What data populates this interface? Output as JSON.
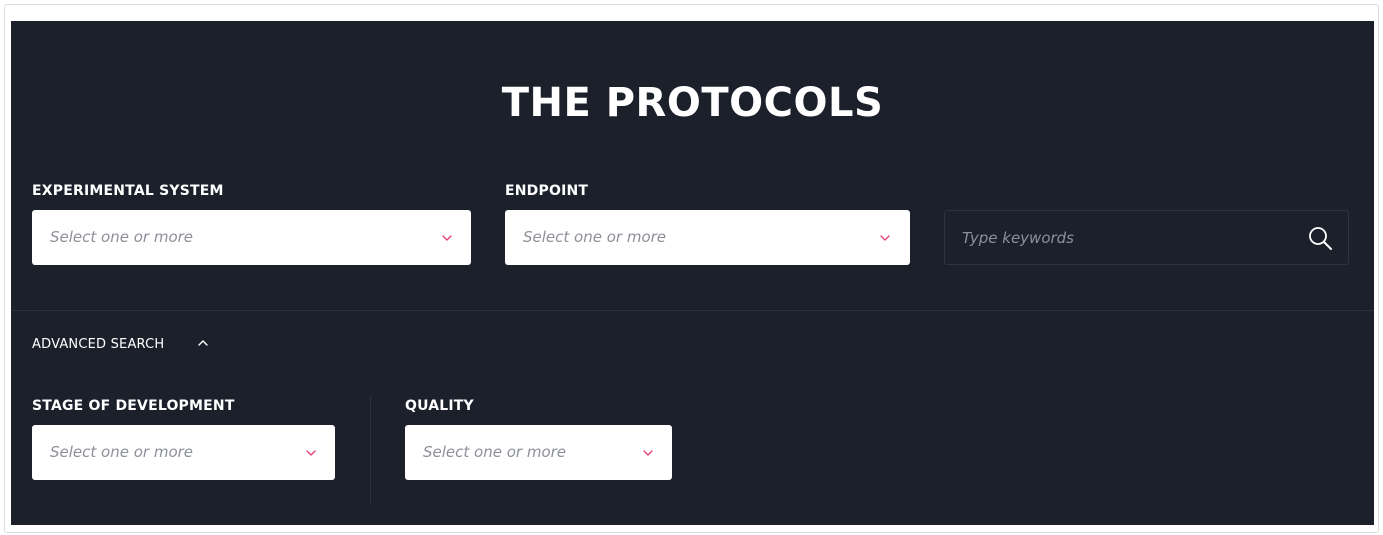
{
  "header": {
    "title": "THE PROTOCOLS"
  },
  "filters": {
    "experimental_system": {
      "label": "EXPERIMENTAL SYSTEM",
      "placeholder": "Select one or more"
    },
    "endpoint": {
      "label": "ENDPOINT",
      "placeholder": "Select one or more"
    },
    "keywords": {
      "placeholder": "Type keywords"
    }
  },
  "advanced": {
    "label": "ADVANCED SEARCH",
    "expanded": true,
    "stage_of_development": {
      "label": "STAGE OF DEVELOPMENT",
      "placeholder": "Select one or more"
    },
    "quality": {
      "label": "QUALITY",
      "placeholder": "Select one or more"
    }
  },
  "colors": {
    "panel_bg": "#1b202b",
    "chevron_accent": "#e3447a",
    "placeholder_text": "#8d9099",
    "label_text": "#ffffff"
  },
  "icons": {
    "dropdown": "chevron-down-icon",
    "search": "search-icon",
    "collapse": "chevron-up-icon"
  }
}
